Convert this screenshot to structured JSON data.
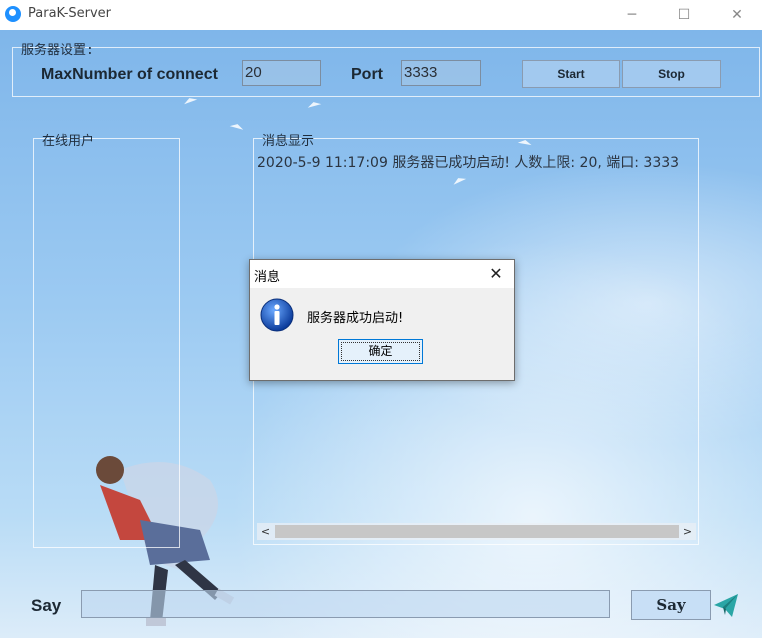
{
  "window": {
    "title": "ParaK-Server",
    "minimize_glyph": "─",
    "maximize_glyph": "☐",
    "close_glyph": "✕"
  },
  "settings": {
    "group_title": "服务器设置:",
    "max_label": "MaxNumber of connect",
    "max_value": "20",
    "port_label": "Port",
    "port_value": "3333",
    "start_label": "Start",
    "stop_label": "Stop"
  },
  "online_users": {
    "group_title": "在线用户"
  },
  "messages": {
    "group_title": "消息显示",
    "lines": [
      "2020-5-9 11:17:09 服务器已成功启动! 人数上限: 20, 端口: 3333"
    ],
    "scroll_left": "<",
    "scroll_right": ">"
  },
  "say": {
    "label": "Say",
    "input_value": "",
    "button_label": "Say",
    "send_icon": "paper-plane-icon"
  },
  "dialog": {
    "title": "消息",
    "message": "服务器成功启动!",
    "ok_label": "确定",
    "close_glyph": "✕",
    "icon": "info-icon"
  },
  "colors": {
    "sky_top": "#7fb6ea",
    "sky_bottom": "#dcecf9",
    "accent": "#0078d7",
    "send_icon": "#2aa6a6"
  }
}
